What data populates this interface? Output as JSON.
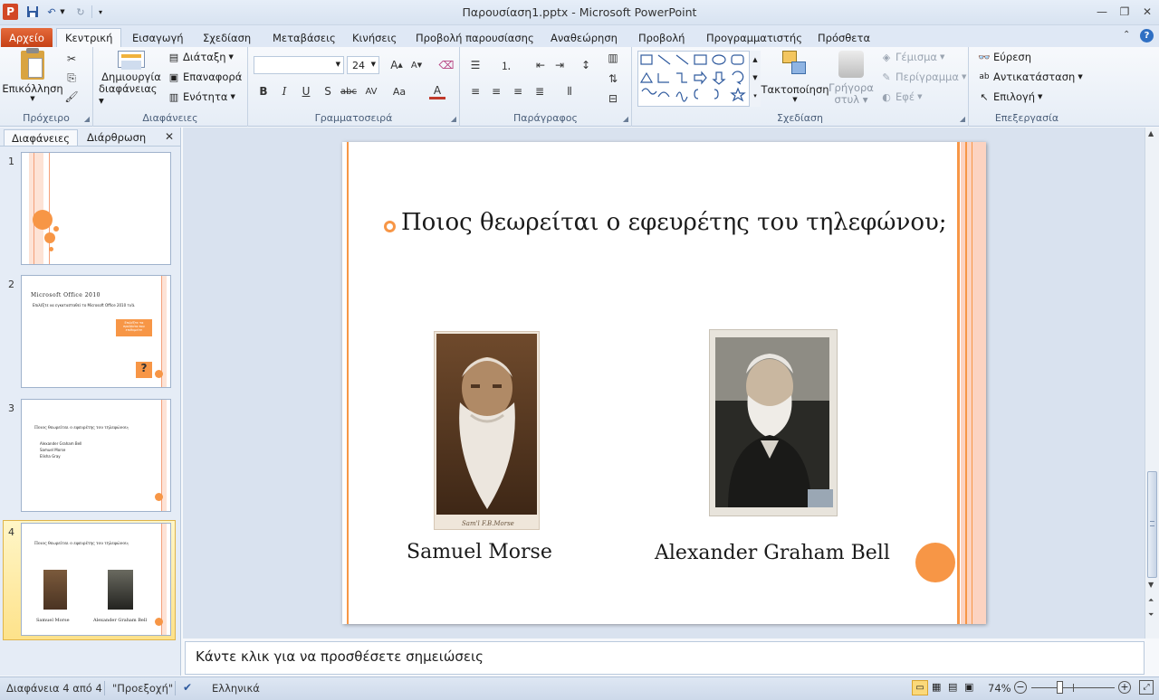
{
  "window": {
    "title": "Παρουσίαση1.pptx  -  Microsoft PowerPoint",
    "app_icon": "P"
  },
  "ribbon_tabs": [
    {
      "label": "Αρχείο"
    },
    {
      "label": "Κεντρική"
    },
    {
      "label": "Εισαγωγή"
    },
    {
      "label": "Σχεδίαση"
    },
    {
      "label": "Μεταβάσεις"
    },
    {
      "label": "Κινήσεις"
    },
    {
      "label": "Προβολή παρουσίασης"
    },
    {
      "label": "Αναθεώρηση"
    },
    {
      "label": "Προβολή"
    },
    {
      "label": "Προγραμματιστής"
    },
    {
      "label": "Πρόσθετα"
    }
  ],
  "groups": {
    "clipboard": {
      "label": "Πρόχειρο",
      "paste": "Επικόλληση"
    },
    "slides": {
      "label": "Διαφάνειες",
      "new_slide_line1": "Δημιουργία",
      "new_slide_line2": "διαφάνειας",
      "layout": "Διάταξη",
      "reset": "Επαναφορά",
      "section": "Ενότητα"
    },
    "font": {
      "label": "Γραμματοσειρά",
      "size": "24"
    },
    "paragraph": {
      "label": "Παράγραφος"
    },
    "drawing": {
      "label": "Σχεδίαση",
      "arrange": "Τακτοποίηση",
      "quick_styles_line1": "Γρήγορα",
      "quick_styles_line2": "στυλ",
      "fill": "Γέμισμα",
      "outline": "Περίγραμμα",
      "effects": "Εφέ"
    },
    "editing": {
      "label": "Επεξεργασία",
      "find": "Εύρεση",
      "replace": "Αντικατάσταση",
      "select": "Επιλογή"
    }
  },
  "panel": {
    "tab_slides": "Διαφάνειες",
    "tab_outline": "Διάρθρωση",
    "thumbnails": [
      {
        "number": "1"
      },
      {
        "number": "2",
        "title": "Microsoft Office 2010",
        "bullet": "Επιλέξτε να εγκατασταθεί το Microsoft Office 2010 τι/ά.",
        "box": "Επιλέξτε τα προϊόντα που επιθυμείτε",
        "icon": "?"
      },
      {
        "number": "3",
        "bullet": "Ποιος θεωρείται ο εφευρέτης του τηλεφώνου;",
        "items": [
          "Alexander Graham Bell",
          "Samuel Morse",
          "Elisha Gray"
        ]
      },
      {
        "number": "4",
        "bullet": "Ποιος θεωρείται ο εφευρέτης του τηλεφώνου;",
        "name1": "Samuel Morse",
        "name2": "Alexander Graham Bell"
      }
    ]
  },
  "slide": {
    "question": "Ποιος θεωρείται ο εφευρέτης του τηλεφώνου;",
    "name_left": "Samuel Morse",
    "name_right": "Alexander Graham Bell",
    "accent_color": "#f79646"
  },
  "notes": {
    "placeholder": "Κάντε κλικ για να προσθέσετε σημειώσεις"
  },
  "status": {
    "slide_of": "Διαφάνεια 4 από 4",
    "theme": "\"Προεξοχή\"",
    "language": "Ελληνικά",
    "zoom": "74%"
  }
}
